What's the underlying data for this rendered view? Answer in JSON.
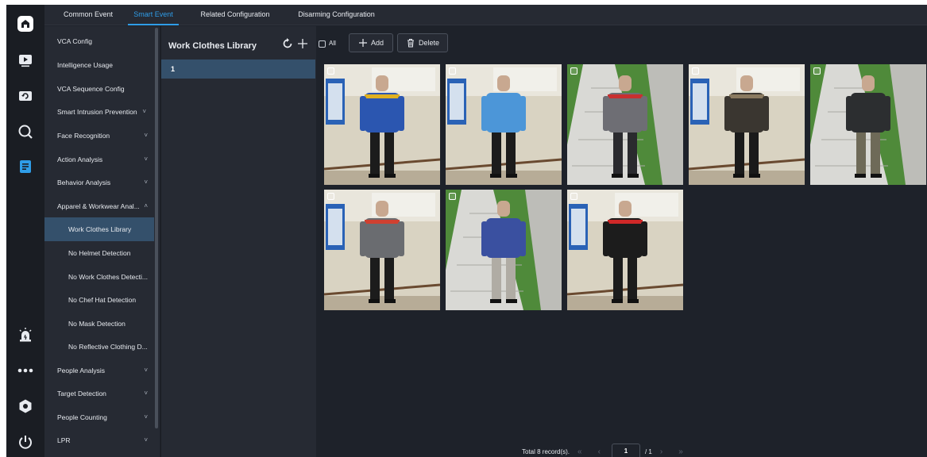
{
  "tabs": [
    {
      "label": "Common Event",
      "active": false
    },
    {
      "label": "Smart Event",
      "active": true
    },
    {
      "label": "Related Configuration",
      "active": false
    },
    {
      "label": "Disarming Configuration",
      "active": false
    }
  ],
  "rail": {
    "top_icons": [
      "home-icon",
      "playback-icon",
      "replay-icon",
      "search-icon",
      "config-icon"
    ],
    "bottom_icons": [
      "alarm-icon",
      "more-icon",
      "settings-icon",
      "power-icon"
    ]
  },
  "menu": {
    "items": [
      {
        "label": "VCA Config",
        "chevron": ""
      },
      {
        "label": "Intelligence Usage",
        "chevron": ""
      },
      {
        "label": "VCA Sequence Config",
        "chevron": ""
      },
      {
        "label": "Smart Intrusion Prevention",
        "chevron": "˅"
      },
      {
        "label": "Face Recognition",
        "chevron": "˅"
      },
      {
        "label": "Action Analysis",
        "chevron": "˅"
      },
      {
        "label": "Behavior Analysis",
        "chevron": "˅"
      },
      {
        "label": "Apparel & Workwear Anal...",
        "chevron": "˄"
      },
      {
        "label": "Work Clothes Library",
        "chevron": "",
        "sub": true,
        "selected": true
      },
      {
        "label": "No Helmet Detection",
        "chevron": "",
        "sub": true
      },
      {
        "label": "No Work Clothes Detecti...",
        "chevron": "",
        "sub": true
      },
      {
        "label": "No Chef Hat Detection",
        "chevron": "",
        "sub": true
      },
      {
        "label": "No Mask Detection",
        "chevron": "",
        "sub": true
      },
      {
        "label": "No Reflective Clothing D...",
        "chevron": "",
        "sub": true
      },
      {
        "label": "People Analysis",
        "chevron": "˅"
      },
      {
        "label": "Target Detection",
        "chevron": "˅"
      },
      {
        "label": "People Counting",
        "chevron": "˅"
      },
      {
        "label": "LPR",
        "chevron": "˅"
      }
    ]
  },
  "library": {
    "title": "Work Clothes Library",
    "rows": [
      "1"
    ]
  },
  "toolbar": {
    "all_label": "All",
    "add_label": "Add",
    "delete_label": "Delete"
  },
  "photos": [
    {
      "bg": "indoor",
      "top": "#2b56b0",
      "pants": "#1c1c1c",
      "accent": "#e0b020"
    },
    {
      "bg": "indoor",
      "top": "#4c96d8",
      "pants": "#1c1c1c",
      "accent": ""
    },
    {
      "bg": "outdoor",
      "top": "#6e6e74",
      "pants": "#2a2a2e",
      "accent": "#c83030"
    },
    {
      "bg": "indoor",
      "top": "#3a3630",
      "pants": "#1a1a1a",
      "accent": "#8a7a60"
    },
    {
      "bg": "outdoor",
      "top": "#2c2e30",
      "pants": "#6e6a58",
      "accent": ""
    },
    {
      "bg": "indoor",
      "top": "#6a6c70",
      "pants": "#1c1c1c",
      "accent": "#d04030"
    },
    {
      "bg": "outdoor",
      "top": "#3a50a0",
      "pants": "#b0aca4",
      "accent": ""
    },
    {
      "bg": "indoor",
      "top": "#1c1c1c",
      "pants": "#1c1c1c",
      "accent": "#d02828"
    }
  ],
  "pager": {
    "total": "Total 8 record(s).",
    "current": "1",
    "of": "/ 1",
    "first": "«",
    "prev": "‹",
    "next": "›",
    "last": "»"
  }
}
